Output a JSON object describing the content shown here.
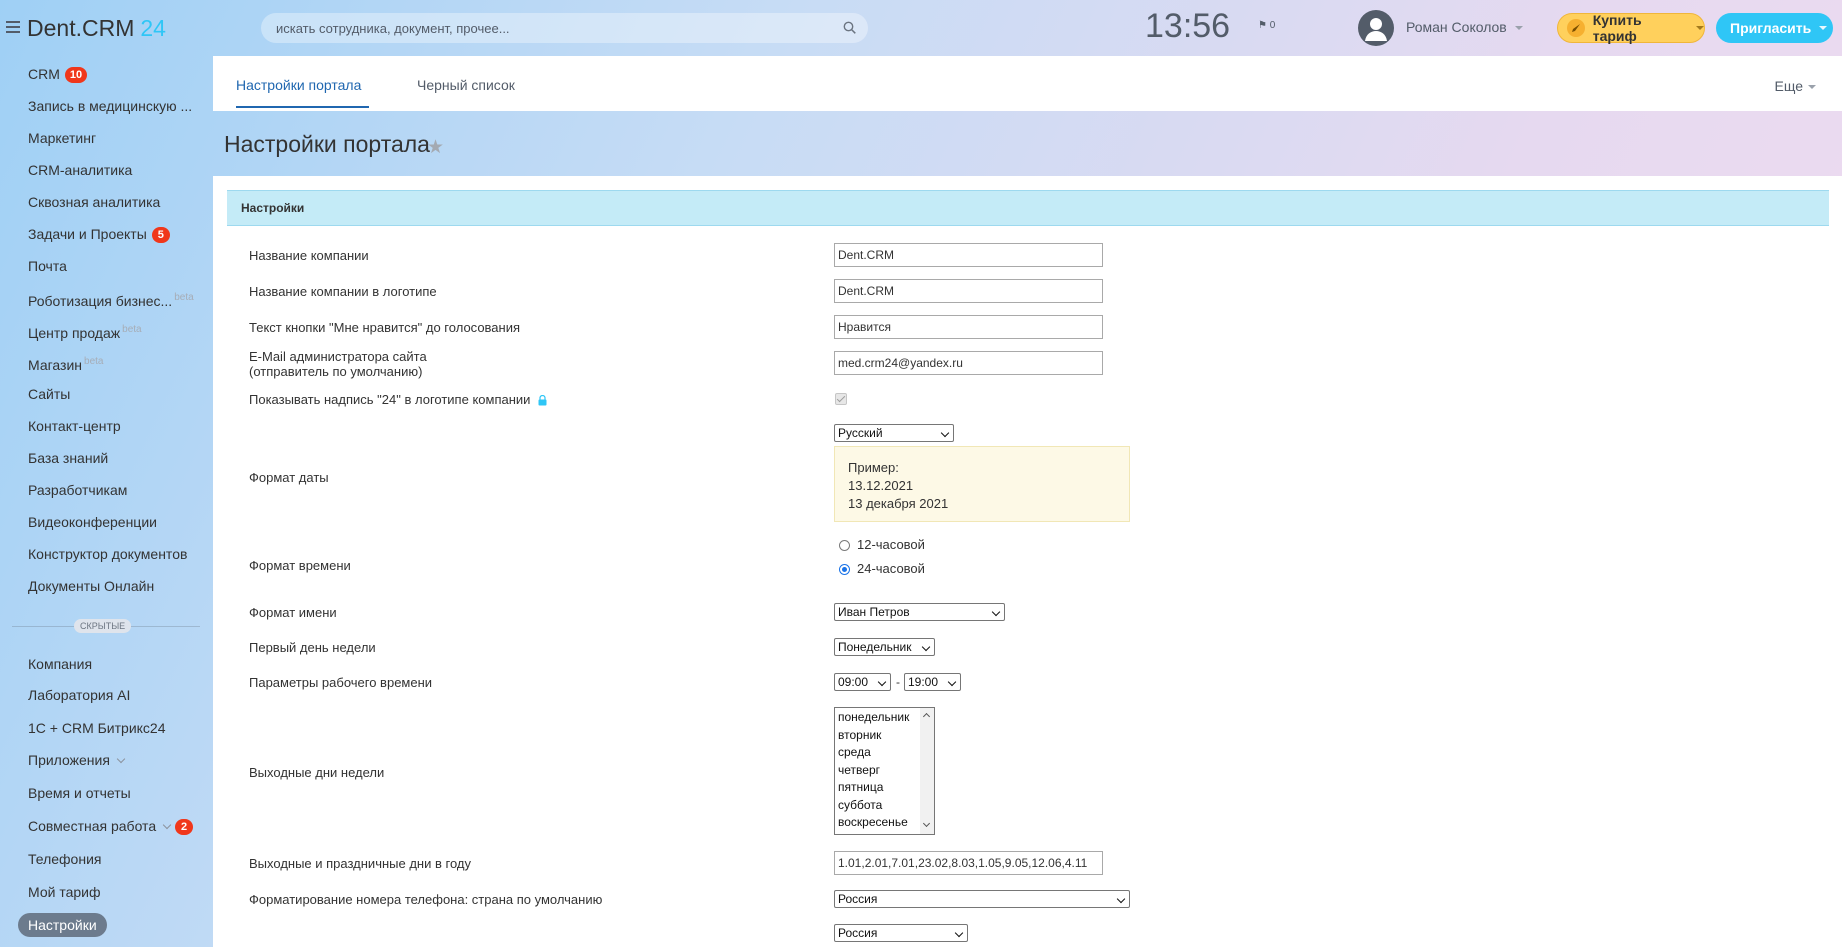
{
  "header": {
    "logo_text": "Dent.CRM",
    "logo_suffix": "24",
    "search_placeholder": "искать сотрудника, документ, прочее...",
    "clock": "13:56",
    "flag_count": "0",
    "user_name": "Роман Соколов",
    "buy_label": "Купить тариф",
    "invite_label": "Пригласить"
  },
  "sidebar": {
    "items": [
      {
        "label": "CRM",
        "badge": "10"
      },
      {
        "label": "Запись в медицинскую ..."
      },
      {
        "label": "Маркетинг"
      },
      {
        "label": "CRM-аналитика"
      },
      {
        "label": "Сквозная аналитика"
      },
      {
        "label": "Задачи и Проекты",
        "badge": "5"
      },
      {
        "label": "Почта"
      },
      {
        "label": "Роботизация бизнес...",
        "beta": "beta"
      },
      {
        "label": "Центр продаж",
        "beta": "beta"
      },
      {
        "label": "Магазин",
        "beta": "beta"
      },
      {
        "label": "Сайты"
      },
      {
        "label": "Контакт-центр"
      },
      {
        "label": "База знаний"
      },
      {
        "label": "Разработчикам"
      },
      {
        "label": "Видеоконференции"
      },
      {
        "label": "Конструктор документов"
      },
      {
        "label": "Документы Онлайн"
      }
    ],
    "hidden_label": "СКРЫТЫЕ",
    "hidden_items": [
      {
        "label": "Компания"
      },
      {
        "label": "Лаборатория AI"
      },
      {
        "label": "1С + CRM Битрикс24"
      },
      {
        "label": "Приложения"
      },
      {
        "label": "Время и отчеты"
      },
      {
        "label": "Совместная работа",
        "badge": "2"
      },
      {
        "label": "Телефония"
      },
      {
        "label": "Мой тариф"
      },
      {
        "label": "Настройки"
      }
    ]
  },
  "tabs": {
    "items": [
      "Настройки портала",
      "Черный список"
    ],
    "more": "Еще"
  },
  "page": {
    "title": "Настройки портала",
    "section": "Настройки"
  },
  "form": {
    "company_name_label": "Название компании",
    "company_name_value": "Dent.CRM",
    "logo_name_label": "Название компании в логотипе",
    "logo_name_value": "Dent.CRM",
    "like_label": "Текст кнопки \"Мне нравится\" до голосования",
    "like_value": "Нравится",
    "email_label_1": "E-Mail администратора сайта",
    "email_label_2": "(отправитель по умолчанию)",
    "email_value": "med.crm24@yandex.ru",
    "show24_label": "Показывать надпись \"24\" в логотипе компании",
    "date_format_label": "Формат даты",
    "date_lang": "Русский",
    "example_title": "Пример:",
    "example_1": "13.12.2021",
    "example_2": "13 декабря 2021",
    "time_format_label": "Формат времени",
    "time_12": "12-часовой",
    "time_24": "24-часовой",
    "name_format_label": "Формат имени",
    "name_format_value": "Иван Петров",
    "first_day_label": "Первый день недели",
    "first_day_value": "Понедельник",
    "work_hours_label": "Параметры рабочего времени",
    "work_from": "09:00",
    "work_dash": "-",
    "work_to": "19:00",
    "weekend_label": "Выходные дни недели",
    "weekdays": [
      "понедельник",
      "вторник",
      "среда",
      "четверг",
      "пятница",
      "суббота",
      "воскресенье"
    ],
    "holidays_label": "Выходные и праздничные дни в году",
    "holidays_value": "1.01,2.01,7.01,23.02,8.03,1.05,9.05,12.06,4.11",
    "phone_format_label": "Форматирование номера телефона: страна по умолчанию",
    "phone_country": "Россия",
    "next_country": "Россия"
  }
}
